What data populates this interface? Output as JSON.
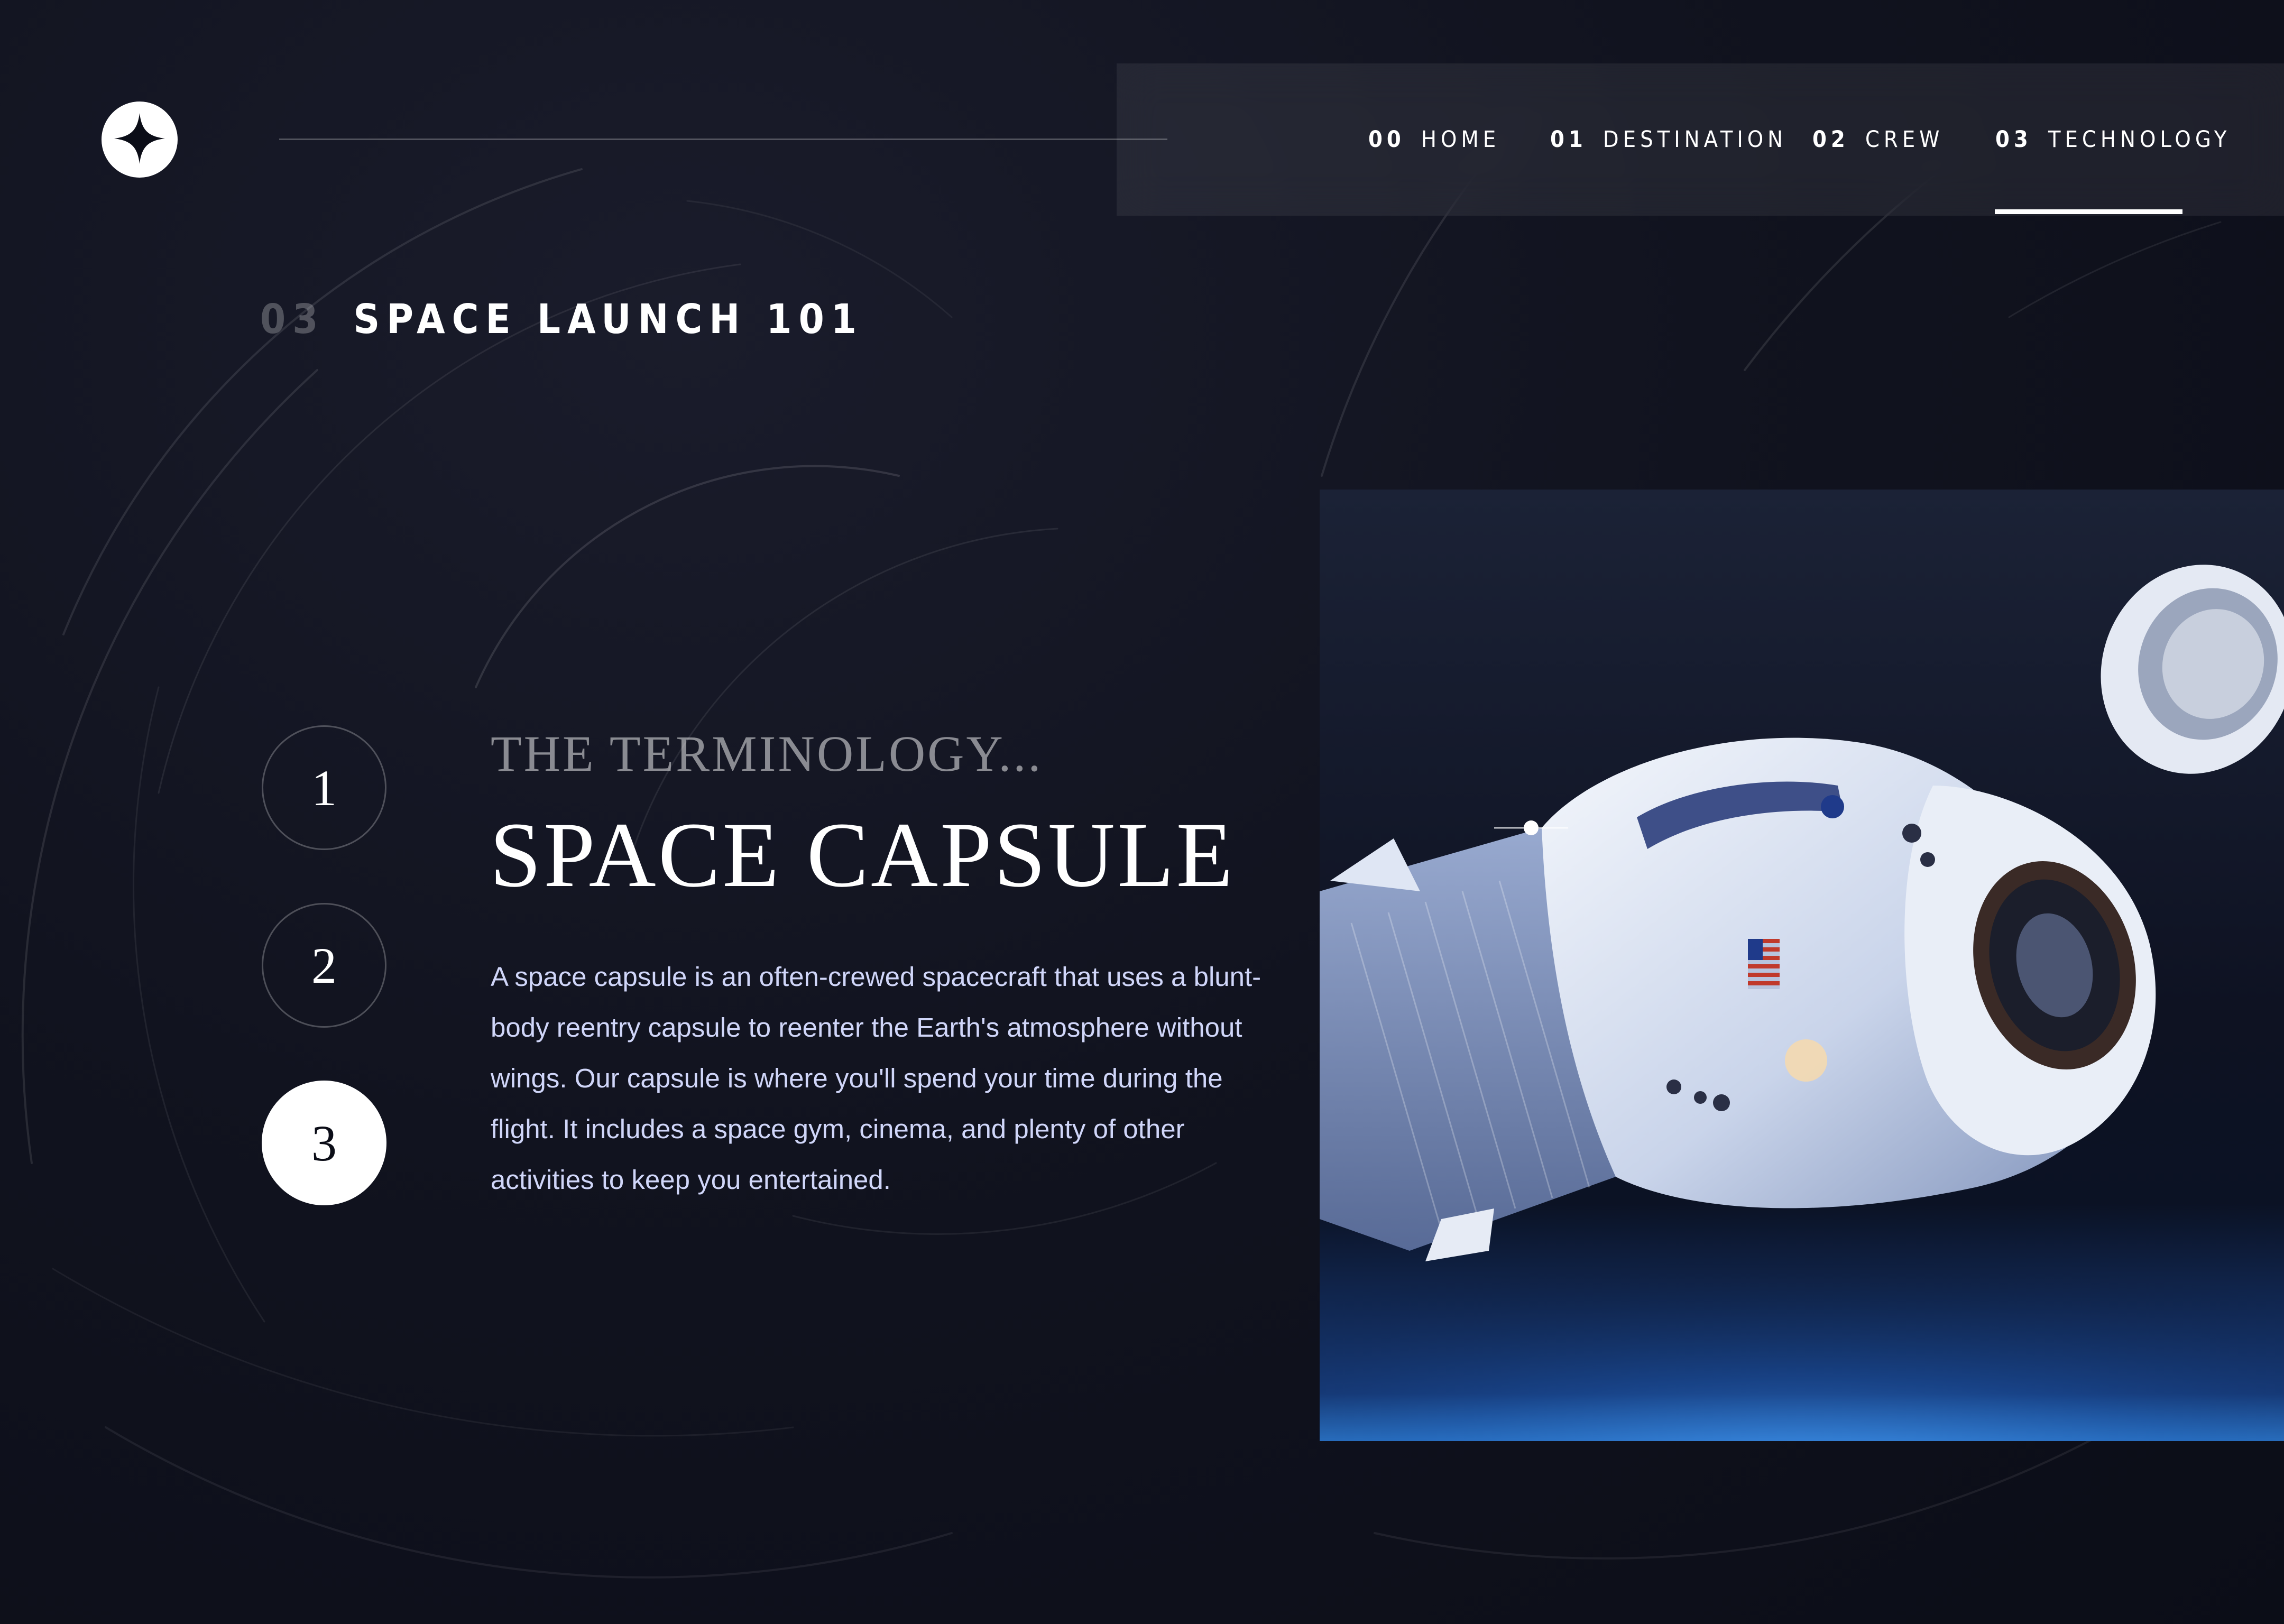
{
  "nav": {
    "items": [
      {
        "num": "00",
        "label": "HOME"
      },
      {
        "num": "01",
        "label": "DESTINATION"
      },
      {
        "num": "02",
        "label": "CREW"
      },
      {
        "num": "03",
        "label": "TECHNOLOGY"
      }
    ],
    "active_index": 3
  },
  "page_heading": {
    "num": "03",
    "title": "SPACE LAUNCH 101"
  },
  "steps": {
    "items": [
      "1",
      "2",
      "3"
    ],
    "active_index": 2
  },
  "content": {
    "eyebrow": "THE TERMINOLOGY...",
    "title": "SPACE CAPSULE",
    "description": "A space capsule is an often-crewed spacecraft that uses a blunt-body reentry capsule to reenter the Earth's atmosphere without wings. Our capsule is where you'll spend your time during the flight. It includes a space gym, cinema, and plenty of other activities to keep you entertained."
  },
  "icons": {
    "logo": "star-logo-icon"
  },
  "colors": {
    "background": "#0b0d17",
    "accent": "#ffffff",
    "text_muted": "#d0d6f9"
  }
}
